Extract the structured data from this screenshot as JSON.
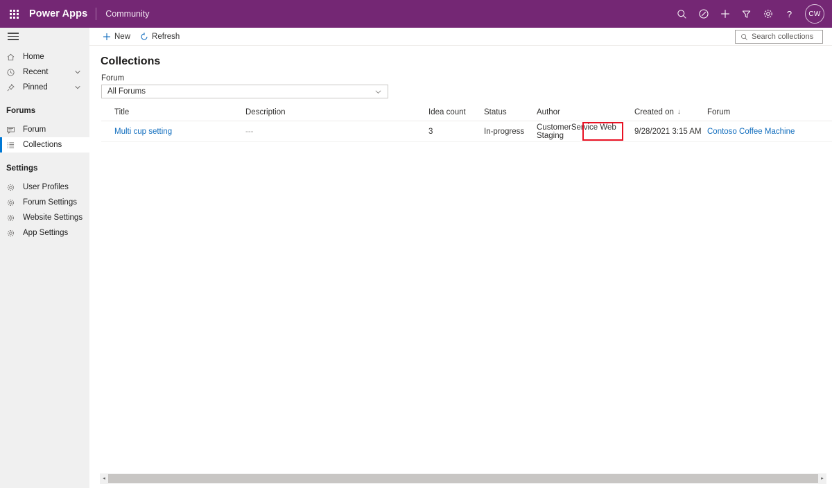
{
  "appbar": {
    "waffle_icon": "waffle-icon",
    "brand": "Power Apps",
    "subbrand": "Community",
    "icons": [
      {
        "name": "search-icon",
        "title": "Search"
      },
      {
        "name": "environment-icon",
        "title": "Environment"
      },
      {
        "name": "plus-icon",
        "title": "New"
      },
      {
        "name": "filter-icon",
        "title": "Filter"
      },
      {
        "name": "gear-icon",
        "title": "Settings"
      },
      {
        "name": "help-icon",
        "title": "Help"
      }
    ],
    "help_glyph": "?",
    "avatar_initials": "CW",
    "background": "#742774"
  },
  "sidebar": {
    "hamburger": "hamburger-icon",
    "items": [
      {
        "label": "Home",
        "icon": "home-icon",
        "chevron": false,
        "selected": false
      },
      {
        "label": "Recent",
        "icon": "clock-icon",
        "chevron": true,
        "selected": false
      },
      {
        "label": "Pinned",
        "icon": "pin-icon",
        "chevron": true,
        "selected": false
      }
    ],
    "groups": [
      {
        "title": "Forums",
        "items": [
          {
            "label": "Forum",
            "icon": "forum-icon",
            "selected": false
          },
          {
            "label": "Collections",
            "icon": "collections-icon",
            "selected": true
          }
        ]
      },
      {
        "title": "Settings",
        "items": [
          {
            "label": "User Profiles",
            "icon": "gear-icon",
            "selected": false
          },
          {
            "label": "Forum Settings",
            "icon": "gear-icon",
            "selected": false
          },
          {
            "label": "Website Settings",
            "icon": "gear-icon",
            "selected": false
          },
          {
            "label": "App Settings",
            "icon": "gear-icon",
            "selected": false
          }
        ]
      }
    ],
    "selected_accent": "#0078d4"
  },
  "commandbar": {
    "new_label": "New",
    "refresh_label": "Refresh",
    "search_placeholder": "Search collections"
  },
  "main": {
    "page_title": "Collections",
    "filter_label": "Forum",
    "filter_value": "All Forums",
    "table": {
      "columns": [
        {
          "key": "title",
          "label": "Title"
        },
        {
          "key": "description",
          "label": "Description"
        },
        {
          "key": "idea_count",
          "label": "Idea count"
        },
        {
          "key": "status",
          "label": "Status"
        },
        {
          "key": "author",
          "label": "Author"
        },
        {
          "key": "created_on",
          "label": "Created on",
          "sorted": "desc",
          "sort_glyph": "↓"
        },
        {
          "key": "forum",
          "label": "Forum"
        }
      ],
      "rows": [
        {
          "title": "Multi cup setting",
          "description": "---",
          "idea_count": "3",
          "status": "In-progress",
          "author": "CustomerService Web Staging",
          "created_on": "9/28/2021 3:15 AM",
          "forum": "Contoso Coffee Machine"
        }
      ]
    }
  },
  "annotation": {
    "target": "In-progress",
    "color": "#e81123"
  },
  "scrollbar": {
    "left_arrow": "◂",
    "right_arrow": "▸"
  }
}
